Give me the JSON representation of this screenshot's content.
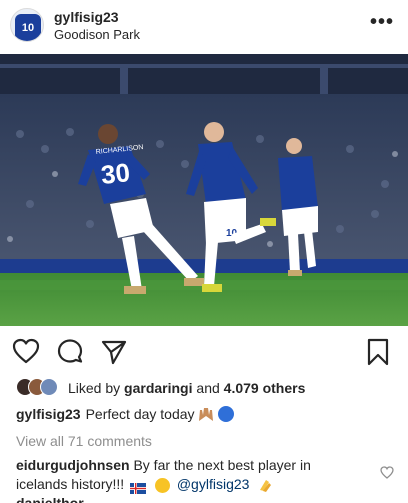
{
  "post": {
    "username": "gylfisig23",
    "location": "Goodison Park",
    "avatar_number": "10",
    "more_label": "•••"
  },
  "photo": {
    "player_left_name": "RICHARLISON",
    "player_left_number": "30",
    "player_center_number": "10",
    "pitch_color": "#3f8a34",
    "kit_color": "#1b3f9c"
  },
  "likes": {
    "prefix": "Liked by ",
    "liker": "gardaringi",
    "middle": " and ",
    "count": "4.079 others"
  },
  "caption": {
    "username": "gylfisig23",
    "text": "Perfect day today"
  },
  "comments": {
    "view_all": "View all 71 comments",
    "items": [
      {
        "username": "eidurgudjohnsen",
        "text": "By far the next best player in icelands history!!!",
        "mention": "@gylfisig23"
      }
    ],
    "next_username": "danielthor"
  },
  "icons": {
    "like": "heart-icon",
    "comment": "comment-icon",
    "share": "share-icon",
    "save": "bookmark-icon",
    "more": "more-icon"
  }
}
